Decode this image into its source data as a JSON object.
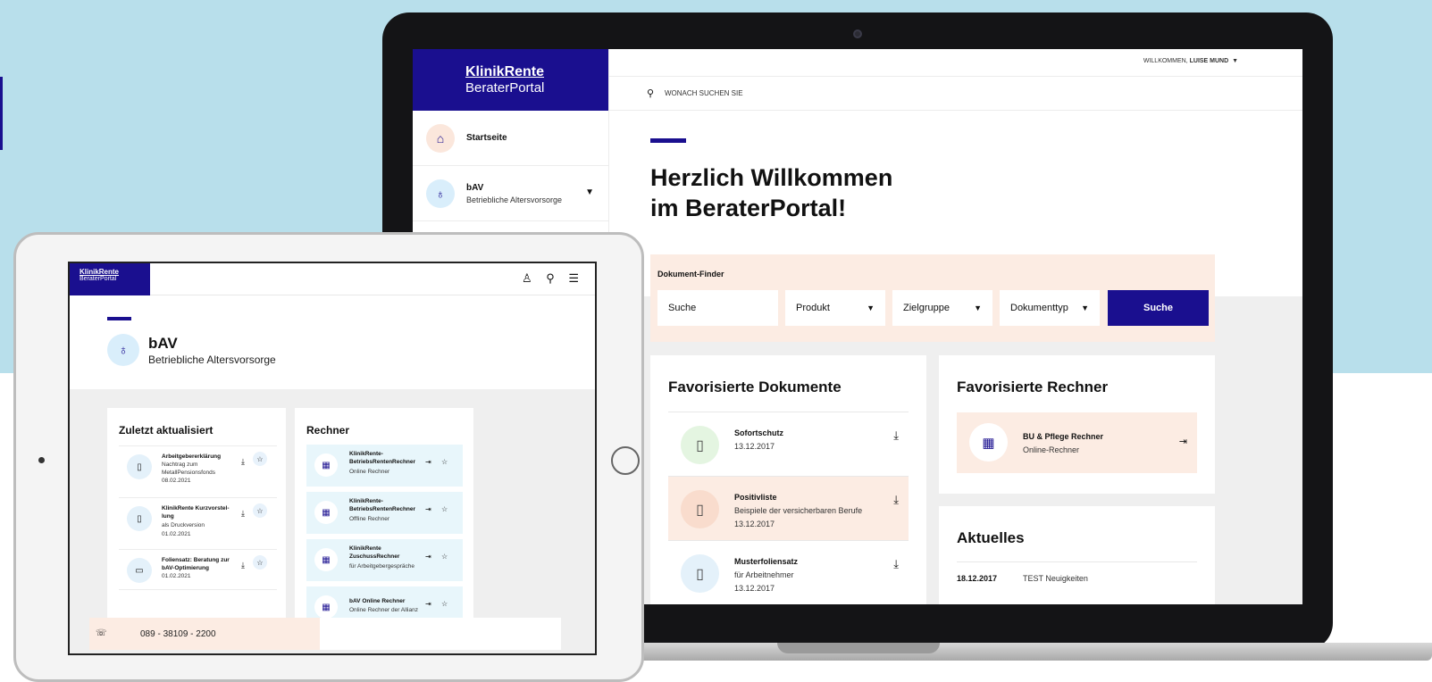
{
  "desktop": {
    "logo": {
      "brand": "KlinikRente",
      "subtitle": "BeraterPortal"
    },
    "header": {
      "welcome_prefix": "WILLKOMMEN,",
      "user_name": "LUISE MUND",
      "search_placeholder": "WONACH SUCHEN SIE"
    },
    "sidebar": {
      "items": [
        {
          "title": "Startseite",
          "icon": "home-icon"
        },
        {
          "title": "bAV",
          "subtitle": "Betriebliche Altersvorsorge",
          "icon": "money-bag-icon"
        }
      ]
    },
    "hero": {
      "line1": "Herzlich Willkommen",
      "line2": "im BeraterPortal!"
    },
    "finder": {
      "label": "Dokument-Finder",
      "search_placeholder": "Suche",
      "product": "Produkt",
      "target_group": "Zielgruppe",
      "doc_type": "Dokumenttyp",
      "submit": "Suche"
    },
    "fav_docs": {
      "title": "Favorisierte Dokumente",
      "items": [
        {
          "title": "Sofortschutz",
          "subtitle": "",
          "date": "13.12.2017"
        },
        {
          "title": "Positivliste",
          "subtitle": "Beispiele der versicherbaren Berufe",
          "date": "13.12.2017"
        },
        {
          "title": "Musterfoliensatz",
          "subtitle": "für Arbeitnehmer",
          "date": "13.12.2017"
        }
      ]
    },
    "fav_calc": {
      "title": "Favorisierte Rechner",
      "item": {
        "title": "BU & Pflege Rechner",
        "subtitle": "Online-Rechner"
      }
    },
    "news": {
      "title": "Aktuelles",
      "date": "18.12.2017",
      "text": "TEST Neuigkeiten"
    }
  },
  "tablet": {
    "logo": {
      "brand": "KlinikRente",
      "subtitle": "BeraterPortal"
    },
    "header_icons": "♙ ⚲ ☰",
    "section": {
      "title": "bAV",
      "subtitle": "Betriebliche Altersvorsorge"
    },
    "recent": {
      "title": "Zuletzt aktualisiert",
      "items": [
        {
          "title": "Arbeitgebererklärung",
          "subtitle": "Nachtrag zum MetallPensionsfonds",
          "date": "08.02.2021"
        },
        {
          "title": "KlinikRente Kurzvorstel-lung",
          "subtitle": "als Druckversion",
          "date": "01.02.2021"
        },
        {
          "title": "Foliensatz: Beratung zur bAV-Optimierung",
          "subtitle": "",
          "date": "01.02.2021"
        }
      ]
    },
    "calculators": {
      "title": "Rechner",
      "items": [
        {
          "title": "KlinikRente-BetriebsRentenRechner",
          "subtitle": "Online Rechner"
        },
        {
          "title": "KlinikRente-BetriebsRentenRechner",
          "subtitle": "Offline Rechner"
        },
        {
          "title": "KlinikRente ZuschussRechner",
          "subtitle": "für Arbeitgebergespräche"
        },
        {
          "title": "bAV Online Rechner",
          "subtitle": "Online Rechner der Allianz"
        }
      ]
    },
    "phone": "089 - 38109 - 2200"
  },
  "colors": {
    "brand": "#1a0f8f",
    "peach": "#fcece3",
    "sky": "#b8dfeb"
  }
}
